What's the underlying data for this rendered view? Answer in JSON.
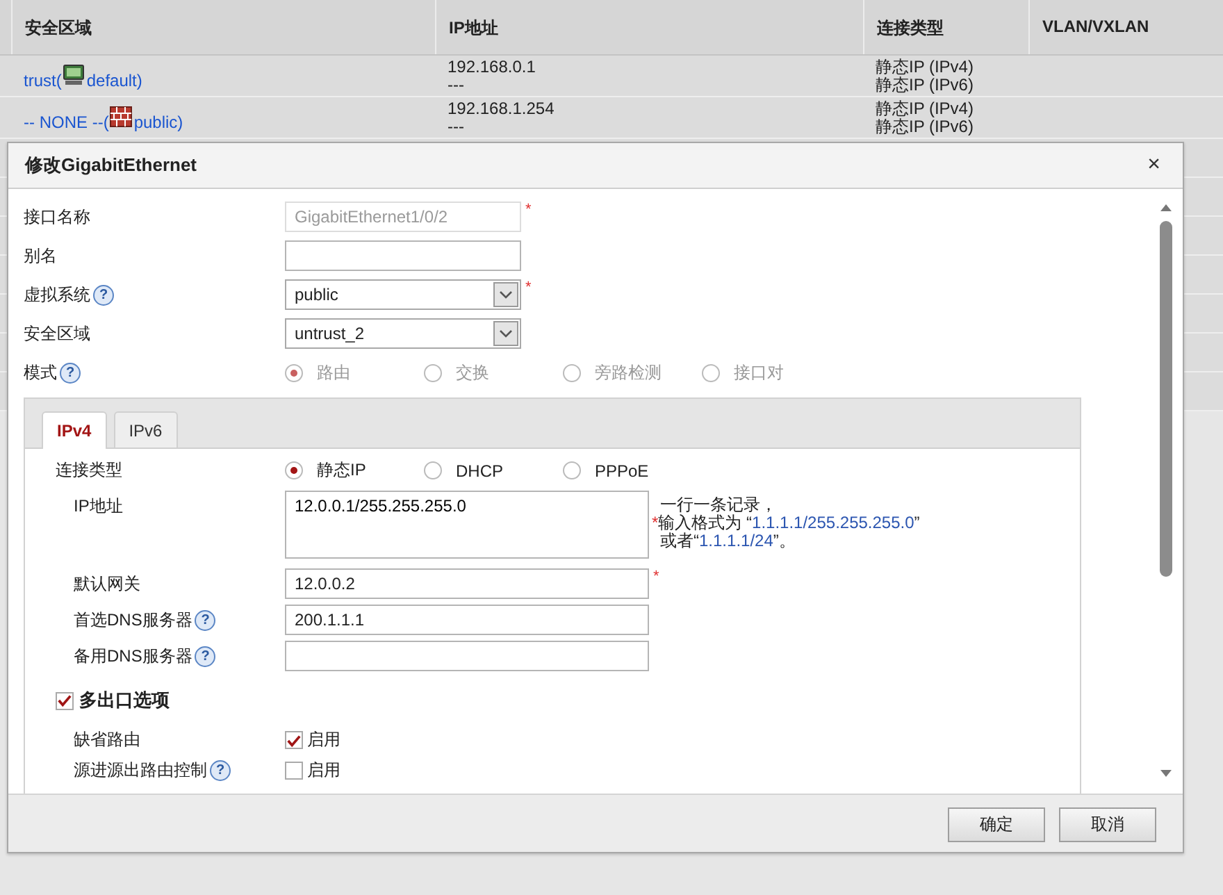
{
  "table": {
    "columns": [
      "安全区域",
      "IP地址",
      "连接类型",
      "VLAN/VXLAN"
    ],
    "rows": [
      {
        "kind": "monitor",
        "zone_before": "trust(",
        "zone_after": " default)",
        "ip": [
          "192.168.0.1",
          "---"
        ],
        "connection": [
          "静态IP (IPv4)",
          "静态IP (IPv6)"
        ]
      },
      {
        "kind": "wall",
        "zone_before": "-- NONE --(",
        "zone_after": " public)",
        "ip": [
          "192.168.1.254",
          "---"
        ],
        "connection": [
          "静态IP (IPv4)",
          "静态IP (IPv6)"
        ]
      }
    ]
  },
  "dialog": {
    "title": "修改GigabitEthernet",
    "close": "×",
    "fields": [
      {
        "kind": "text",
        "label": "接口名称",
        "value": "GigabitEthernet1/0/2",
        "disabled": true,
        "required_mark": "*"
      },
      {
        "kind": "text",
        "label": "别名",
        "disabled": false
      },
      {
        "kind": "select",
        "label": "虚拟系统",
        "value": "public",
        "help": "?",
        "required_mark": "*"
      },
      {
        "kind": "select",
        "label": "安全区域",
        "value": "untrust_2"
      },
      {
        "kind": "radio",
        "label": "模式",
        "help": "?",
        "disabled": true,
        "options": [
          {
            "label": "路由",
            "selected": true
          },
          {
            "label": "交换",
            "selected": false
          },
          {
            "label": "旁路检测",
            "selected": false
          },
          {
            "label": "接口对",
            "selected": false
          }
        ]
      }
    ],
    "tabs": [
      {
        "label": "IPv4",
        "selected": true
      },
      {
        "label": "IPv6",
        "selected": false
      }
    ],
    "ipv4_fields": [
      {
        "kind": "radio",
        "label": "连接类型",
        "disabled": false,
        "options": [
          {
            "label": "静态IP",
            "selected": true
          },
          {
            "label": "DHCP",
            "selected": false
          },
          {
            "label": "PPPoE",
            "selected": false
          }
        ]
      },
      {
        "kind": "textarea",
        "label": "IP地址",
        "value": "12.0.0.1/255.255.255.0",
        "hint": [
          [
            {
              "kind": "plain",
              "text": "一行一条记录，"
            }
          ],
          [
            {
              "kind": "mark",
              "text": "*"
            },
            {
              "kind": "plain",
              "text": "输入格式为 “"
            },
            {
              "kind": "value",
              "text": "1.1.1.1/255.255.255.0"
            },
            {
              "kind": "plain",
              "text": "”"
            }
          ],
          [
            {
              "kind": "plain",
              "text": "或者“"
            },
            {
              "kind": "value",
              "text": "1.1.1.1/24"
            },
            {
              "kind": "plain",
              "text": "”。"
            }
          ]
        ]
      },
      {
        "kind": "text",
        "label": "默认网关",
        "value": "12.0.0.2",
        "disabled": false,
        "required_mark": "*"
      },
      {
        "kind": "text",
        "label": "首选DNS服务器",
        "value": "200.1.1.1",
        "help": "?",
        "disabled": false
      },
      {
        "kind": "text",
        "label": "备用DNS服务器",
        "help": "?",
        "disabled": false
      },
      {
        "kind": "section",
        "label": "多出口选项",
        "checked": true
      },
      {
        "kind": "checkbox",
        "label": "缺省路由",
        "option": "启用",
        "checked": true
      },
      {
        "kind": "checkbox",
        "label": "源进源出路由控制",
        "help": "?",
        "option": "启用",
        "checked": false
      }
    ]
  },
  "buttons": [
    "确定",
    "取消"
  ]
}
